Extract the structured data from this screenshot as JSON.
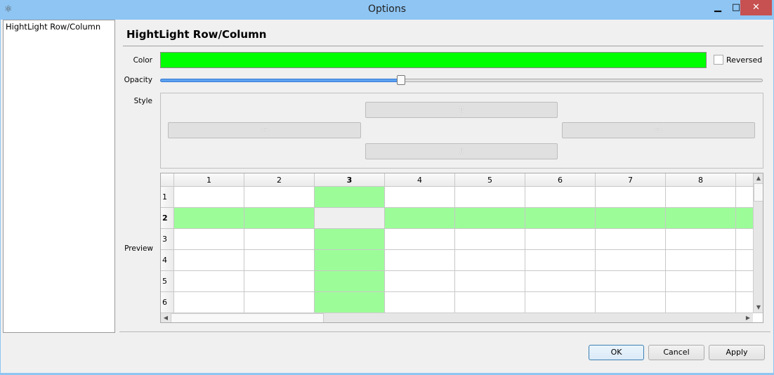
{
  "window": {
    "title": "Options",
    "minimize": "▁",
    "maximize": "□",
    "close": "✕",
    "close_color": "#c75050"
  },
  "sidebar": {
    "items": [
      {
        "label": "HightLight Row/Column"
      }
    ]
  },
  "panel": {
    "heading": "HightLight Row/Column",
    "color_label": "Color",
    "color_value": "#00ff00",
    "reversed_label": "Reversed",
    "reversed_checked": false,
    "opacity_label": "Opacity",
    "opacity_fraction": 0.4,
    "style_label": "Style",
    "style_buttons": {
      "up": "⇧",
      "left": "⇦",
      "right": "⇨",
      "down": "⇩"
    },
    "preview_label": "Preview",
    "preview": {
      "columns": [
        "1",
        "2",
        "3",
        "4",
        "5",
        "6",
        "7",
        "8",
        ""
      ],
      "rows": [
        "1",
        "2",
        "3",
        "4",
        "5",
        "6"
      ],
      "current_row": "2",
      "current_column": "3",
      "highlight_color": "#9cfd98"
    }
  },
  "footer": {
    "ok": "OK",
    "cancel": "Cancel",
    "apply": "Apply"
  }
}
